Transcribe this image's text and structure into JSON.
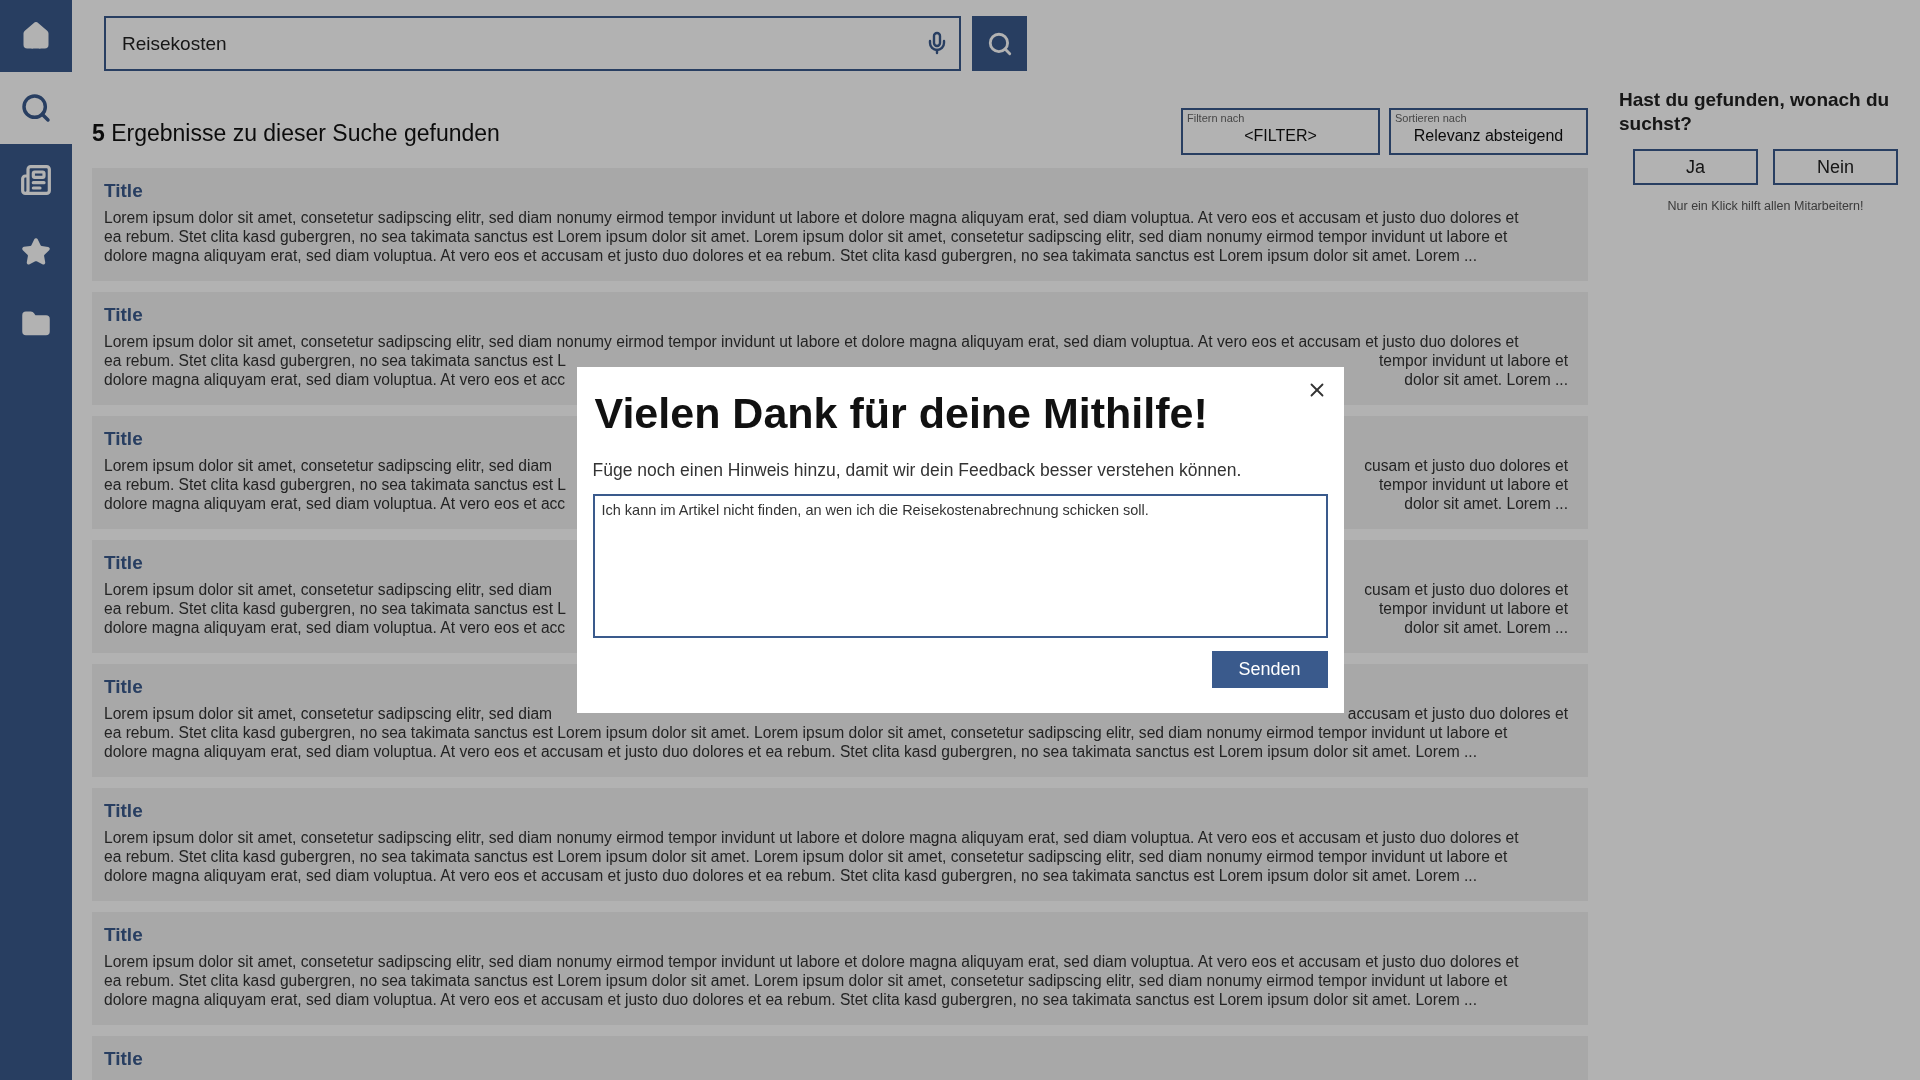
{
  "sidebar": {
    "items": [
      {
        "kind": "home",
        "selected": false
      },
      {
        "kind": "search",
        "selected": true
      },
      {
        "kind": "articles",
        "selected": false
      },
      {
        "kind": "favorites",
        "selected": false
      },
      {
        "kind": "folder",
        "selected": false
      }
    ]
  },
  "search": {
    "value": "Reisekosten"
  },
  "results_heading": {
    "count": "5",
    "text": "Ergebnisse zu dieser Suche gefunden"
  },
  "filters": [
    {
      "label": "Filtern nach",
      "value": "<FILTER>"
    },
    {
      "label": "Sortieren nach",
      "value": "Relevanz absteigend"
    }
  ],
  "results": [
    {
      "title": "Title",
      "lines": [
        {
          "kind": "full",
          "text": "Lorem ipsum dolor sit amet, consetetur sadipscing elitr, sed diam nonumy eirmod tempor invidunt ut labore et dolore magna aliquyam erat, sed diam voluptua. At vero eos et accusam et justo duo dolores et"
        },
        {
          "kind": "full",
          "text": "ea rebum. Stet clita kasd gubergren, no sea takimata sanctus est Lorem ipsum dolor sit amet. Lorem ipsum dolor sit amet, consetetur sadipscing elitr, sed diam nonumy eirmod tempor invidunt ut labore et"
        },
        {
          "kind": "full",
          "text": "dolore magna aliquyam erat, sed diam voluptua. At vero eos et accusam et justo duo dolores et ea rebum. Stet clita kasd gubergren, no sea takimata sanctus est Lorem ipsum dolor sit amet. Lorem ..."
        }
      ]
    },
    {
      "title": "Title",
      "lines": [
        {
          "kind": "full",
          "text": "Lorem ipsum dolor sit amet, consetetur sadipscing elitr, sed diam nonumy eirmod tempor invidunt ut labore et dolore magna aliquyam erat, sed diam voluptua. At vero eos et accusam et justo duo dolores et"
        },
        {
          "kind": "split",
          "left": "ea rebum. Stet clita kasd gubergren, no sea takimata sanctus est L",
          "right": "tempor invidunt ut labore et"
        },
        {
          "kind": "split",
          "left": "dolore magna aliquyam erat, sed diam voluptua. At vero eos et acc",
          "right": "dolor sit amet. Lorem ..."
        }
      ]
    },
    {
      "title": "Title",
      "lines": [
        {
          "kind": "split",
          "left": "Lorem ipsum dolor sit amet, consetetur sadipscing elitr, sed diam",
          "right": "cusam et justo duo dolores et"
        },
        {
          "kind": "split",
          "left": "ea rebum. Stet clita kasd gubergren, no sea takimata sanctus est L",
          "right": "tempor invidunt ut labore et"
        },
        {
          "kind": "split",
          "left": "dolore magna aliquyam erat, sed diam voluptua. At vero eos et acc",
          "right": "dolor sit amet. Lorem ..."
        }
      ]
    },
    {
      "title": "Title",
      "lines": [
        {
          "kind": "split",
          "left": "Lorem ipsum dolor sit amet, consetetur sadipscing elitr, sed diam",
          "right": "cusam et justo duo dolores et"
        },
        {
          "kind": "split",
          "left": "ea rebum. Stet clita kasd gubergren, no sea takimata sanctus est L",
          "right": "tempor invidunt ut labore et"
        },
        {
          "kind": "split",
          "left": "dolore magna aliquyam erat, sed diam voluptua. At vero eos et acc",
          "right": "dolor sit amet. Lorem ..."
        }
      ]
    },
    {
      "title": "Title",
      "lines": [
        {
          "kind": "split",
          "left": "Lorem ipsum dolor sit amet, consetetur sadipscing elitr, sed diam",
          "right": "accusam et justo duo dolores et"
        },
        {
          "kind": "full",
          "text": "ea rebum. Stet clita kasd gubergren, no sea takimata sanctus est Lorem ipsum dolor sit amet. Lorem ipsum dolor sit amet, consetetur sadipscing elitr, sed diam nonumy eirmod tempor invidunt ut labore et"
        },
        {
          "kind": "full",
          "text": "dolore magna aliquyam erat, sed diam voluptua. At vero eos et accusam et justo duo dolores et ea rebum. Stet clita kasd gubergren, no sea takimata sanctus est Lorem ipsum dolor sit amet. Lorem ..."
        }
      ]
    },
    {
      "title": "Title",
      "lines": [
        {
          "kind": "full",
          "text": "Lorem ipsum dolor sit amet, consetetur sadipscing elitr, sed diam nonumy eirmod tempor invidunt ut labore et dolore magna aliquyam erat, sed diam voluptua. At vero eos et accusam et justo duo dolores et"
        },
        {
          "kind": "full",
          "text": "ea rebum. Stet clita kasd gubergren, no sea takimata sanctus est Lorem ipsum dolor sit amet. Lorem ipsum dolor sit amet, consetetur sadipscing elitr, sed diam nonumy eirmod tempor invidunt ut labore et"
        },
        {
          "kind": "full",
          "text": "dolore magna aliquyam erat, sed diam voluptua. At vero eos et accusam et justo duo dolores et ea rebum. Stet clita kasd gubergren, no sea takimata sanctus est Lorem ipsum dolor sit amet. Lorem ..."
        }
      ]
    },
    {
      "title": "Title",
      "lines": [
        {
          "kind": "full",
          "text": "Lorem ipsum dolor sit amet, consetetur sadipscing elitr, sed diam nonumy eirmod tempor invidunt ut labore et dolore magna aliquyam erat, sed diam voluptua. At vero eos et accusam et justo duo dolores et"
        },
        {
          "kind": "full",
          "text": "ea rebum. Stet clita kasd gubergren, no sea takimata sanctus est Lorem ipsum dolor sit amet. Lorem ipsum dolor sit amet, consetetur sadipscing elitr, sed diam nonumy eirmod tempor invidunt ut labore et"
        },
        {
          "kind": "full",
          "text": "dolore magna aliquyam erat, sed diam voluptua. At vero eos et accusam et justo duo dolores et ea rebum. Stet clita kasd gubergren, no sea takimata sanctus est Lorem ipsum dolor sit amet. Lorem ..."
        }
      ]
    },
    {
      "title": "Title"
    }
  ],
  "feedback": {
    "question": "Hast du gefunden, wonach du suchst?",
    "buttons": [
      "Ja",
      "Nein"
    ],
    "note": "Nur ein Klick hilft allen Mitarbeitern!"
  },
  "dialog": {
    "title": "Vielen Dank für deine Mithilfe!",
    "prompt": "Füge noch einen Hinweis hinzu, damit wir dein Feedback besser verstehen können.",
    "comment": "Ich kann im Artikel nicht finden, an wen ich die Reisekostenabrechnung schicken soll.",
    "submit": "Senden"
  }
}
